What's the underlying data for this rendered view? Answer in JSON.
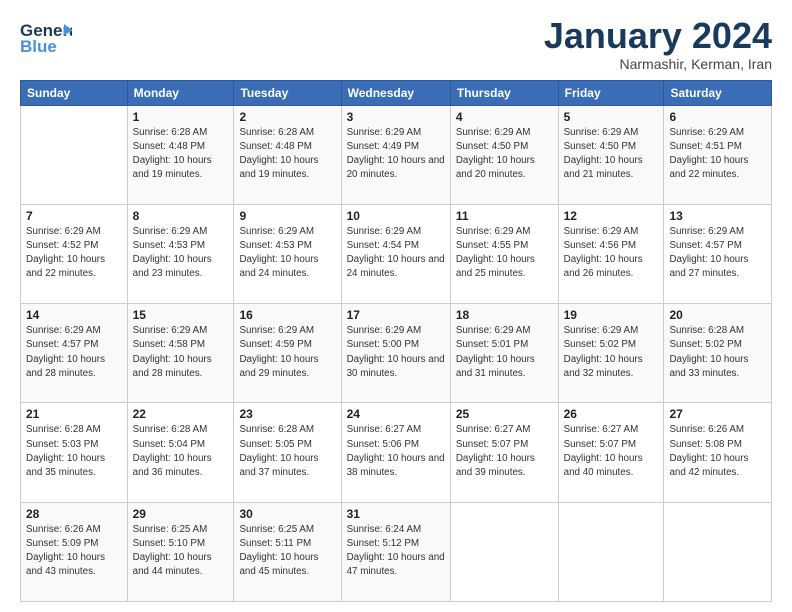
{
  "logo": {
    "line1": "General",
    "line2": "Blue"
  },
  "title": "January 2024",
  "location": "Narmashir, Kerman, Iran",
  "days_header": [
    "Sunday",
    "Monday",
    "Tuesday",
    "Wednesday",
    "Thursday",
    "Friday",
    "Saturday"
  ],
  "weeks": [
    [
      {
        "num": "",
        "sunrise": "",
        "sunset": "",
        "daylight": ""
      },
      {
        "num": "1",
        "sunrise": "Sunrise: 6:28 AM",
        "sunset": "Sunset: 4:48 PM",
        "daylight": "Daylight: 10 hours and 19 minutes."
      },
      {
        "num": "2",
        "sunrise": "Sunrise: 6:28 AM",
        "sunset": "Sunset: 4:48 PM",
        "daylight": "Daylight: 10 hours and 19 minutes."
      },
      {
        "num": "3",
        "sunrise": "Sunrise: 6:29 AM",
        "sunset": "Sunset: 4:49 PM",
        "daylight": "Daylight: 10 hours and 20 minutes."
      },
      {
        "num": "4",
        "sunrise": "Sunrise: 6:29 AM",
        "sunset": "Sunset: 4:50 PM",
        "daylight": "Daylight: 10 hours and 20 minutes."
      },
      {
        "num": "5",
        "sunrise": "Sunrise: 6:29 AM",
        "sunset": "Sunset: 4:50 PM",
        "daylight": "Daylight: 10 hours and 21 minutes."
      },
      {
        "num": "6",
        "sunrise": "Sunrise: 6:29 AM",
        "sunset": "Sunset: 4:51 PM",
        "daylight": "Daylight: 10 hours and 22 minutes."
      }
    ],
    [
      {
        "num": "7",
        "sunrise": "Sunrise: 6:29 AM",
        "sunset": "Sunset: 4:52 PM",
        "daylight": "Daylight: 10 hours and 22 minutes."
      },
      {
        "num": "8",
        "sunrise": "Sunrise: 6:29 AM",
        "sunset": "Sunset: 4:53 PM",
        "daylight": "Daylight: 10 hours and 23 minutes."
      },
      {
        "num": "9",
        "sunrise": "Sunrise: 6:29 AM",
        "sunset": "Sunset: 4:53 PM",
        "daylight": "Daylight: 10 hours and 24 minutes."
      },
      {
        "num": "10",
        "sunrise": "Sunrise: 6:29 AM",
        "sunset": "Sunset: 4:54 PM",
        "daylight": "Daylight: 10 hours and 24 minutes."
      },
      {
        "num": "11",
        "sunrise": "Sunrise: 6:29 AM",
        "sunset": "Sunset: 4:55 PM",
        "daylight": "Daylight: 10 hours and 25 minutes."
      },
      {
        "num": "12",
        "sunrise": "Sunrise: 6:29 AM",
        "sunset": "Sunset: 4:56 PM",
        "daylight": "Daylight: 10 hours and 26 minutes."
      },
      {
        "num": "13",
        "sunrise": "Sunrise: 6:29 AM",
        "sunset": "Sunset: 4:57 PM",
        "daylight": "Daylight: 10 hours and 27 minutes."
      }
    ],
    [
      {
        "num": "14",
        "sunrise": "Sunrise: 6:29 AM",
        "sunset": "Sunset: 4:57 PM",
        "daylight": "Daylight: 10 hours and 28 minutes."
      },
      {
        "num": "15",
        "sunrise": "Sunrise: 6:29 AM",
        "sunset": "Sunset: 4:58 PM",
        "daylight": "Daylight: 10 hours and 28 minutes."
      },
      {
        "num": "16",
        "sunrise": "Sunrise: 6:29 AM",
        "sunset": "Sunset: 4:59 PM",
        "daylight": "Daylight: 10 hours and 29 minutes."
      },
      {
        "num": "17",
        "sunrise": "Sunrise: 6:29 AM",
        "sunset": "Sunset: 5:00 PM",
        "daylight": "Daylight: 10 hours and 30 minutes."
      },
      {
        "num": "18",
        "sunrise": "Sunrise: 6:29 AM",
        "sunset": "Sunset: 5:01 PM",
        "daylight": "Daylight: 10 hours and 31 minutes."
      },
      {
        "num": "19",
        "sunrise": "Sunrise: 6:29 AM",
        "sunset": "Sunset: 5:02 PM",
        "daylight": "Daylight: 10 hours and 32 minutes."
      },
      {
        "num": "20",
        "sunrise": "Sunrise: 6:28 AM",
        "sunset": "Sunset: 5:02 PM",
        "daylight": "Daylight: 10 hours and 33 minutes."
      }
    ],
    [
      {
        "num": "21",
        "sunrise": "Sunrise: 6:28 AM",
        "sunset": "Sunset: 5:03 PM",
        "daylight": "Daylight: 10 hours and 35 minutes."
      },
      {
        "num": "22",
        "sunrise": "Sunrise: 6:28 AM",
        "sunset": "Sunset: 5:04 PM",
        "daylight": "Daylight: 10 hours and 36 minutes."
      },
      {
        "num": "23",
        "sunrise": "Sunrise: 6:28 AM",
        "sunset": "Sunset: 5:05 PM",
        "daylight": "Daylight: 10 hours and 37 minutes."
      },
      {
        "num": "24",
        "sunrise": "Sunrise: 6:27 AM",
        "sunset": "Sunset: 5:06 PM",
        "daylight": "Daylight: 10 hours and 38 minutes."
      },
      {
        "num": "25",
        "sunrise": "Sunrise: 6:27 AM",
        "sunset": "Sunset: 5:07 PM",
        "daylight": "Daylight: 10 hours and 39 minutes."
      },
      {
        "num": "26",
        "sunrise": "Sunrise: 6:27 AM",
        "sunset": "Sunset: 5:07 PM",
        "daylight": "Daylight: 10 hours and 40 minutes."
      },
      {
        "num": "27",
        "sunrise": "Sunrise: 6:26 AM",
        "sunset": "Sunset: 5:08 PM",
        "daylight": "Daylight: 10 hours and 42 minutes."
      }
    ],
    [
      {
        "num": "28",
        "sunrise": "Sunrise: 6:26 AM",
        "sunset": "Sunset: 5:09 PM",
        "daylight": "Daylight: 10 hours and 43 minutes."
      },
      {
        "num": "29",
        "sunrise": "Sunrise: 6:25 AM",
        "sunset": "Sunset: 5:10 PM",
        "daylight": "Daylight: 10 hours and 44 minutes."
      },
      {
        "num": "30",
        "sunrise": "Sunrise: 6:25 AM",
        "sunset": "Sunset: 5:11 PM",
        "daylight": "Daylight: 10 hours and 45 minutes."
      },
      {
        "num": "31",
        "sunrise": "Sunrise: 6:24 AM",
        "sunset": "Sunset: 5:12 PM",
        "daylight": "Daylight: 10 hours and 47 minutes."
      },
      {
        "num": "",
        "sunrise": "",
        "sunset": "",
        "daylight": ""
      },
      {
        "num": "",
        "sunrise": "",
        "sunset": "",
        "daylight": ""
      },
      {
        "num": "",
        "sunrise": "",
        "sunset": "",
        "daylight": ""
      }
    ]
  ]
}
